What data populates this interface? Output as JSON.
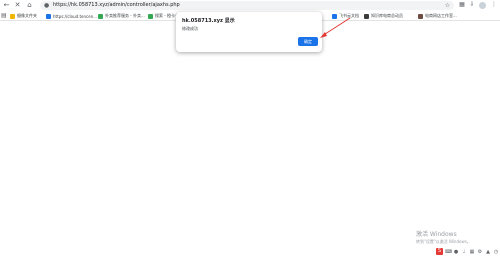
{
  "browser": {
    "url": "https://hk.058713.xyz/admin/controller/ajaxhs.php",
    "icons": {
      "back": "back-arrow-icon",
      "forward": "forward-arrow-icon",
      "reload": "close-icon",
      "home": "home-icon",
      "lock": "lock-icon",
      "bookmark": "star-icon"
    }
  },
  "bookmarks": [
    {
      "label": "摄像文件夹",
      "color": "#f2b705"
    },
    {
      "label": "https://cloud.tencen...",
      "color": "#1a73e8"
    },
    {
      "label": "外卖推荐服务 - 外卖...",
      "color": "#34a853"
    },
    {
      "label": "搜索 - 橙卡书",
      "color": "#34a853"
    },
    {
      "label": "飞书云文档",
      "color": "#1a73e8"
    },
    {
      "label": "知识库电商总动员",
      "color": "#3c3c3c"
    },
    {
      "label": "电商网店工作室...",
      "color": "#6d4c41"
    }
  ],
  "dialog": {
    "title": "hk.058713.xyz 显示",
    "message": "修改成功",
    "ok_label": "确定"
  },
  "watermark": {
    "line1": "激活 Windows",
    "line2": "转到\"设置\"以激活 Windows。"
  },
  "tray": {
    "ime_label": "S"
  },
  "colors": {
    "accent": "#1a73e8",
    "annotation": "#e53935"
  }
}
